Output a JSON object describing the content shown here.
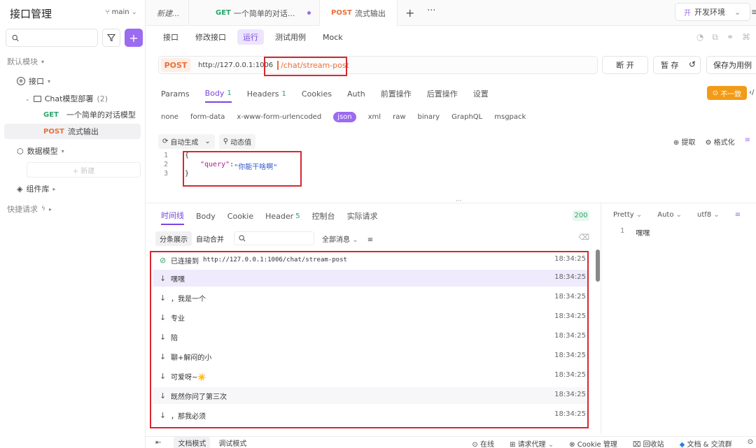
{
  "sidebar": {
    "title": "接口管理",
    "branch": "main",
    "default_module": "默认模块",
    "api_group": "接口",
    "folder": "Chat模型部署",
    "folder_count": "(2)",
    "items": [
      {
        "method": "GET",
        "name": "一个简单的对话模型"
      },
      {
        "method": "POST",
        "name": "流式输出"
      }
    ],
    "data_model": "数据模型",
    "new_label": "+ 新建",
    "component_lib": "组件库",
    "quick_request": "快捷请求"
  },
  "tabs": [
    {
      "label": "新建..."
    },
    {
      "method": "GET",
      "label": "一个简单的对话..."
    },
    {
      "method": "POST",
      "label": "流式输出"
    }
  ],
  "env": "开发环境",
  "subtabs": [
    "接口",
    "修改接口",
    "运行",
    "测试用例",
    "Mock"
  ],
  "active_subtab": "运行",
  "request": {
    "method": "POST",
    "base_url": "http://127.0.0.1:1006",
    "path": "/chat/stream-post",
    "disconnect": "断 开",
    "pause": "暂 存",
    "save_case": "保存为用例"
  },
  "param_tabs": [
    {
      "label": "Params",
      "count": ""
    },
    {
      "label": "Body",
      "count": "1"
    },
    {
      "label": "Headers",
      "count": "1"
    },
    {
      "label": "Cookies",
      "count": ""
    },
    {
      "label": "Auth",
      "count": ""
    },
    {
      "label": "前置操作",
      "count": ""
    },
    {
      "label": "后置操作",
      "count": ""
    },
    {
      "label": "设置",
      "count": ""
    }
  ],
  "warning": "不一致",
  "body_types": [
    "none",
    "form-data",
    "x-www-form-urlencoded",
    "json",
    "xml",
    "raw",
    "binary",
    "GraphQL",
    "msgpack"
  ],
  "active_body_type": "json",
  "editor": {
    "auto_gen": "自动生成",
    "dynamic": "动态值",
    "extract": "提取",
    "format": "格式化",
    "lines": [
      "1",
      "2",
      "3"
    ],
    "open_brace": "{",
    "key": "\"query\"",
    "colon": ": ",
    "value": "\"你能干啥啊\"",
    "close_brace": "}"
  },
  "response_tabs": [
    {
      "label": "时间线",
      "count": ""
    },
    {
      "label": "Body",
      "count": ""
    },
    {
      "label": "Cookie",
      "count": ""
    },
    {
      "label": "Header",
      "count": "5"
    },
    {
      "label": "控制台",
      "count": ""
    },
    {
      "label": "实际请求",
      "count": ""
    }
  ],
  "status_code": "200",
  "response_toolbar": {
    "split": "分条展示",
    "merge": "自动合并",
    "filter": "全部消息"
  },
  "events": [
    {
      "type": "connected",
      "prefix": "已连接到",
      "text": "http://127.0.0.1:1006/chat/stream-post",
      "time": "18:34:25"
    },
    {
      "type": "msg",
      "text": "嘿嘿",
      "time": "18:34:25"
    },
    {
      "type": "msg",
      "text": "，我是一个",
      "time": "18:34:25"
    },
    {
      "type": "msg",
      "text": "专业",
      "time": "18:34:25"
    },
    {
      "type": "msg",
      "text": "陪",
      "time": "18:34:25"
    },
    {
      "type": "msg",
      "text": "聊+解闷的小",
      "time": "18:34:25"
    },
    {
      "type": "msg",
      "text": "可爱呀~☀️",
      "time": "18:34:25"
    },
    {
      "type": "msg",
      "text": "既然你问了第三次",
      "time": "18:34:25"
    },
    {
      "type": "msg",
      "text": "，那我必须",
      "time": "18:34:25"
    }
  ],
  "preview": {
    "mode": "Pretty",
    "auto": "Auto",
    "encoding": "utf8",
    "line": "1",
    "text": "嘿嘿"
  },
  "statusbar": {
    "doc_mode": "文档模式",
    "debug_mode": "调试模式",
    "online": "在线",
    "proxy": "请求代理",
    "cookie": "Cookie 管理",
    "recycle": "回收站",
    "docs": "文档 & 交流群"
  }
}
